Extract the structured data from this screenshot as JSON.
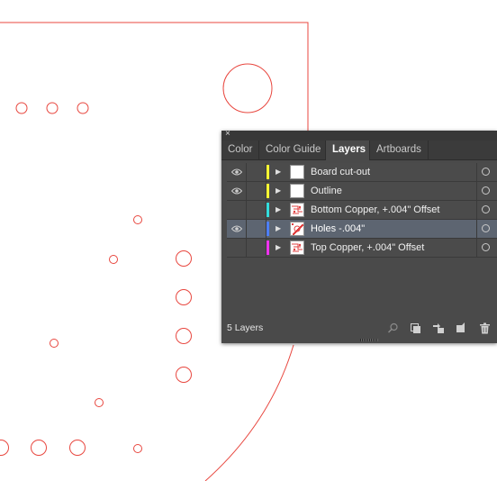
{
  "panel": {
    "close_glyph": "×",
    "tabs": [
      {
        "label": "Color",
        "active": false
      },
      {
        "label": "Color Guide",
        "active": false
      },
      {
        "label": "Layers",
        "active": true
      },
      {
        "label": "Artboards",
        "active": false
      }
    ],
    "layers": [
      {
        "name": "Board cut-out",
        "visible": true,
        "color": "#ffff33",
        "selected": false,
        "thumbnail": "blank"
      },
      {
        "name": "Outline",
        "visible": true,
        "color": "#ffff33",
        "selected": false,
        "thumbnail": "blank"
      },
      {
        "name": "Bottom Copper, +.004\" Offset",
        "visible": false,
        "color": "#33dddd",
        "selected": false,
        "thumbnail": "red-traces"
      },
      {
        "name": "Holes -.004\"",
        "visible": true,
        "color": "#4d7fff",
        "selected": true,
        "thumbnail": "red-dense"
      },
      {
        "name": "Top Copper, +.004\" Offset",
        "visible": false,
        "color": "#ee33ee",
        "selected": false,
        "thumbnail": "red-traces"
      }
    ],
    "footer": {
      "layer_count": "5 Layers",
      "icons": [
        "locate-object-icon",
        "make-clipping-mask-icon",
        "create-sublayer-icon",
        "new-layer-icon",
        "delete-icon"
      ]
    }
  },
  "artwork": {
    "stroke_color": "#e8473f"
  }
}
